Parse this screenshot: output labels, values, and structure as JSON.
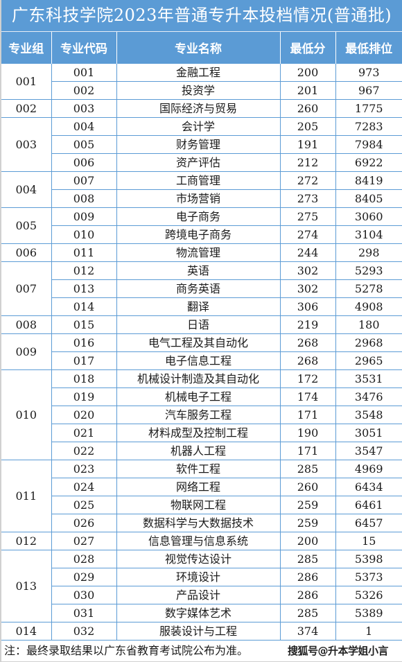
{
  "title": "广东科技学院2023年普通专升本投档情况(普通批)",
  "headers": [
    "专业组",
    "专业代码",
    "专业名称",
    "最低分",
    "最低排位"
  ],
  "groups": [
    {
      "group": "001",
      "rows": [
        {
          "code": "001",
          "name": "金融工程",
          "min_score": "200",
          "min_rank": "973"
        },
        {
          "code": "002",
          "name": "投资学",
          "min_score": "201",
          "min_rank": "967"
        }
      ]
    },
    {
      "group": "002",
      "rows": [
        {
          "code": "003",
          "name": "国际经济与贸易",
          "min_score": "260",
          "min_rank": "1775"
        }
      ]
    },
    {
      "group": "003",
      "rows": [
        {
          "code": "004",
          "name": "会计学",
          "min_score": "205",
          "min_rank": "7283"
        },
        {
          "code": "005",
          "name": "财务管理",
          "min_score": "191",
          "min_rank": "7984"
        },
        {
          "code": "006",
          "name": "资产评估",
          "min_score": "212",
          "min_rank": "6922"
        }
      ]
    },
    {
      "group": "004",
      "rows": [
        {
          "code": "007",
          "name": "工商管理",
          "min_score": "272",
          "min_rank": "8419"
        },
        {
          "code": "008",
          "name": "市场营销",
          "min_score": "273",
          "min_rank": "8405"
        }
      ]
    },
    {
      "group": "005",
      "rows": [
        {
          "code": "009",
          "name": "电子商务",
          "min_score": "275",
          "min_rank": "3060"
        },
        {
          "code": "010",
          "name": "跨境电子商务",
          "min_score": "274",
          "min_rank": "3104"
        }
      ]
    },
    {
      "group": "006",
      "rows": [
        {
          "code": "011",
          "name": "物流管理",
          "min_score": "244",
          "min_rank": "298"
        }
      ]
    },
    {
      "group": "007",
      "rows": [
        {
          "code": "012",
          "name": "英语",
          "min_score": "302",
          "min_rank": "5293"
        },
        {
          "code": "013",
          "name": "商务英语",
          "min_score": "302",
          "min_rank": "5278"
        },
        {
          "code": "014",
          "name": "翻译",
          "min_score": "306",
          "min_rank": "4908"
        }
      ]
    },
    {
      "group": "008",
      "rows": [
        {
          "code": "015",
          "name": "日语",
          "min_score": "219",
          "min_rank": "180"
        }
      ]
    },
    {
      "group": "009",
      "rows": [
        {
          "code": "016",
          "name": "电气工程及其自动化",
          "min_score": "268",
          "min_rank": "2968"
        },
        {
          "code": "017",
          "name": "电子信息工程",
          "min_score": "268",
          "min_rank": "2965"
        }
      ]
    },
    {
      "group": "010",
      "rows": [
        {
          "code": "018",
          "name": "机械设计制造及其自动化",
          "min_score": "172",
          "min_rank": "3531"
        },
        {
          "code": "019",
          "name": "机械电子工程",
          "min_score": "174",
          "min_rank": "3476"
        },
        {
          "code": "020",
          "name": "汽车服务工程",
          "min_score": "171",
          "min_rank": "3548"
        },
        {
          "code": "021",
          "name": "材料成型及控制工程",
          "min_score": "190",
          "min_rank": "3051"
        },
        {
          "code": "022",
          "name": "机器人工程",
          "min_score": "171",
          "min_rank": "3547"
        }
      ]
    },
    {
      "group": "011",
      "rows": [
        {
          "code": "023",
          "name": "软件工程",
          "min_score": "285",
          "min_rank": "4969"
        },
        {
          "code": "024",
          "name": "网络工程",
          "min_score": "260",
          "min_rank": "6434"
        },
        {
          "code": "025",
          "name": "物联网工程",
          "min_score": "259",
          "min_rank": "6461"
        },
        {
          "code": "026",
          "name": "数据科学与大数据技术",
          "min_score": "259",
          "min_rank": "6457"
        }
      ]
    },
    {
      "group": "012",
      "rows": [
        {
          "code": "027",
          "name": "信息管理与信息系统",
          "min_score": "200",
          "min_rank": "15"
        }
      ]
    },
    {
      "group": "013",
      "rows": [
        {
          "code": "028",
          "name": "视觉传达设计",
          "min_score": "285",
          "min_rank": "5398"
        },
        {
          "code": "029",
          "name": "环境设计",
          "min_score": "286",
          "min_rank": "5373"
        },
        {
          "code": "030",
          "name": "产品设计",
          "min_score": "286",
          "min_rank": "5326"
        },
        {
          "code": "031",
          "name": "数字媒体艺术",
          "min_score": "285",
          "min_rank": "5389"
        }
      ]
    },
    {
      "group": "014",
      "rows": [
        {
          "code": "032",
          "name": "服装设计与工程",
          "min_score": "374",
          "min_rank": "1"
        }
      ]
    }
  ],
  "note": "注：最终录取结果以广东省教育考试院公布为准。",
  "watermark": "搜狐号@升本学姐小言",
  "colors": {
    "header_bg": "#5b9bd5",
    "border": "#5b9bd5",
    "header_text": "#ffffff"
  }
}
